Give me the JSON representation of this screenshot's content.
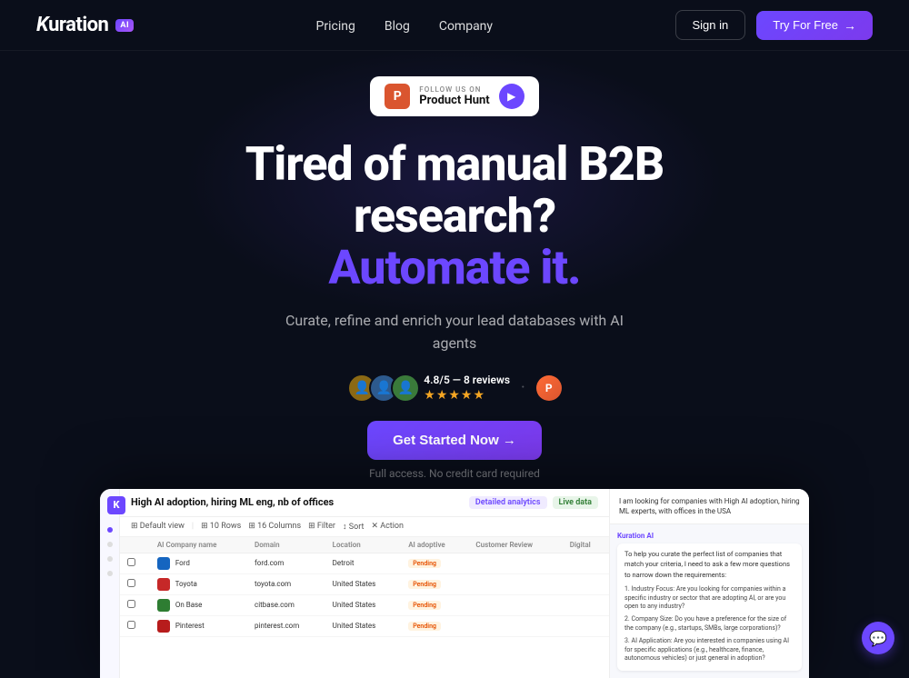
{
  "navbar": {
    "logo": "Kuration",
    "logo_italic": "K",
    "ai_badge": "AI",
    "links": [
      {
        "label": "Pricing",
        "href": "#"
      },
      {
        "label": "Blog",
        "href": "#"
      },
      {
        "label": "Company",
        "href": "#"
      }
    ],
    "signin_label": "Sign in",
    "try_label": "Try For Free",
    "try_arrow": "→"
  },
  "hero": {
    "product_hunt": {
      "follow_text": "FOLLOW US ON",
      "name": "Product Hunt"
    },
    "headline_line1": "Tired of manual B2B",
    "headline_line2": "research?",
    "headline_accent": "Automate it.",
    "subheadline": "Curate, refine and enrich your lead databases with AI agents",
    "rating": "4.8/5 — 8 reviews",
    "stars": "★★★★★",
    "cta_button": "Get Started Now →",
    "cta_note": "Full access. No credit card required"
  },
  "dashboard": {
    "title": "High AI adoption, hiring ML eng, nb of offices",
    "badge_analytics": "Detailed analytics",
    "badge_data": "Live data",
    "toolbar_items": [
      "⊞ Default view",
      "10 Rows",
      "16 Columns",
      "Filter",
      "Sort",
      "Action"
    ],
    "table": {
      "headers": [
        "",
        "AI Company name",
        "Domain",
        "Location",
        "AI adoptive",
        "Customer Review",
        "Digit"
      ],
      "rows": [
        {
          "name": "Ford",
          "domain": "ford.com",
          "location": "Detroit",
          "ai_status": "Pending",
          "logo_color": "#1565c0"
        },
        {
          "name": "Toyota",
          "domain": "toyota.com",
          "location": "United States",
          "ai_status": "Pending",
          "logo_color": "#c62828"
        },
        {
          "name": "On Base",
          "domain": "citbase.com",
          "location": "United States",
          "ai_status": "Pending",
          "logo_color": "#2e7d32"
        },
        {
          "name": "Pinterest",
          "domain": "pinterest.com",
          "location": "United States",
          "ai_status": "Pending",
          "logo_color": "#b71c1c"
        }
      ]
    },
    "chat": {
      "query": "I am looking for companies with High AI adoption, hiring ML experts, with offices in the USA",
      "agent_label": "Kuration AI",
      "response_intro": "To help you curate the perfect list of companies that match your criteria, I need to ask a few more questions to narrow down the requirements:",
      "questions": [
        "1. Industry Focus: Are you looking for companies within a specific industry or sector that are adopting AI, or are you open to any industry?",
        "2. Company Size: Do you have a preference for the size of the company (e.g., startups, SMBs, large corporations)?",
        "3. AI Application: Are you interested in companies using AI for specific applications (e.g., healthcare, finance, autonomous vehicles) or just general in adoption?"
      ]
    },
    "k_logo": "K"
  },
  "chat_float": {
    "icon": "💬"
  }
}
